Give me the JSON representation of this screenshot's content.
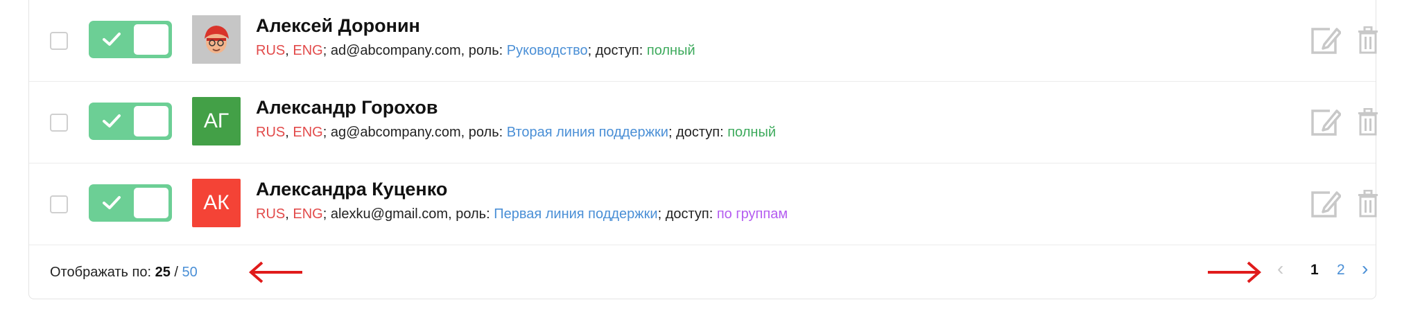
{
  "users": [
    {
      "name": "Алексей Доронин",
      "lang1": "RUS",
      "lang2": "ENG",
      "email": "ad@abcompany.com",
      "role_prefix": ", роль: ",
      "role": "Руководство",
      "access_prefix": "; доступ: ",
      "access": "полный",
      "avatar_type": "photo",
      "enabled": true
    },
    {
      "name": "Александр Горохов",
      "lang1": "RUS",
      "lang2": "ENG",
      "email": "ag@abcompany.com",
      "role_prefix": ", роль: ",
      "role": "Вторая линия поддержки",
      "access_prefix": "; доступ: ",
      "access": "полный",
      "avatar_initials": "АГ",
      "avatar_color": "#43a047",
      "enabled": true
    },
    {
      "name": "Александра Куценко",
      "lang1": "RUS",
      "lang2": "ENG",
      "email": "alexku@gmail.com",
      "role_prefix": ", роль: ",
      "role": "Первая линия поддержки",
      "access_prefix": "; доступ: ",
      "access": "по группам",
      "avatar_initials": "АК",
      "avatar_color": "#f44336",
      "enabled": true
    }
  ],
  "footer": {
    "per_page_label": "Отображать по: ",
    "per_page_current": "25",
    "per_page_sep": " / ",
    "per_page_alt": "50"
  },
  "pagination": {
    "prev": "‹",
    "pages": [
      "1",
      "2"
    ],
    "current": "1",
    "next": "›"
  },
  "colors": {
    "toggle_on": "#6ccf95",
    "language": "#e24a4a",
    "role": "#4a8fd6",
    "access_full": "#3daa5c",
    "access_groups": "#b45cf0",
    "annotation_arrow": "#e01b1b"
  },
  "icons": [
    "checkmark-icon",
    "edit-icon",
    "trash-icon",
    "arrow-left-annotation",
    "arrow-right-annotation"
  ]
}
